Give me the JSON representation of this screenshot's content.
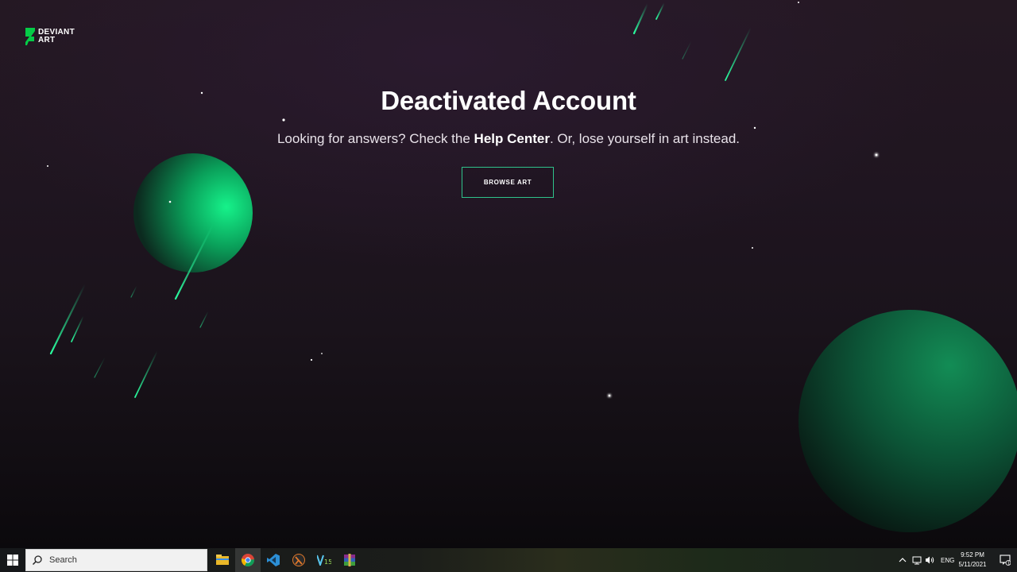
{
  "brand": {
    "logo_text": "DEVIANT\nART",
    "accent": "#05cc47",
    "button_border": "#2fc38b"
  },
  "main": {
    "title": "Deactivated Account",
    "sub_before": "Looking for answers? Check the ",
    "sub_link": "Help Center",
    "sub_after": ". Or, lose yourself in art instead.",
    "browse_button": "BROWSE ART"
  },
  "taskbar": {
    "search_placeholder": "Search",
    "pinned_apps": [
      "file-explorer-icon",
      "chrome-icon",
      "vscode-icon",
      "half-life-icon",
      "vegas-pro-icon",
      "winrar-icon"
    ],
    "tray": {
      "language": "ENG",
      "time": "9:52 PM",
      "date": "5/11/2021",
      "notifications_count": "1"
    }
  }
}
